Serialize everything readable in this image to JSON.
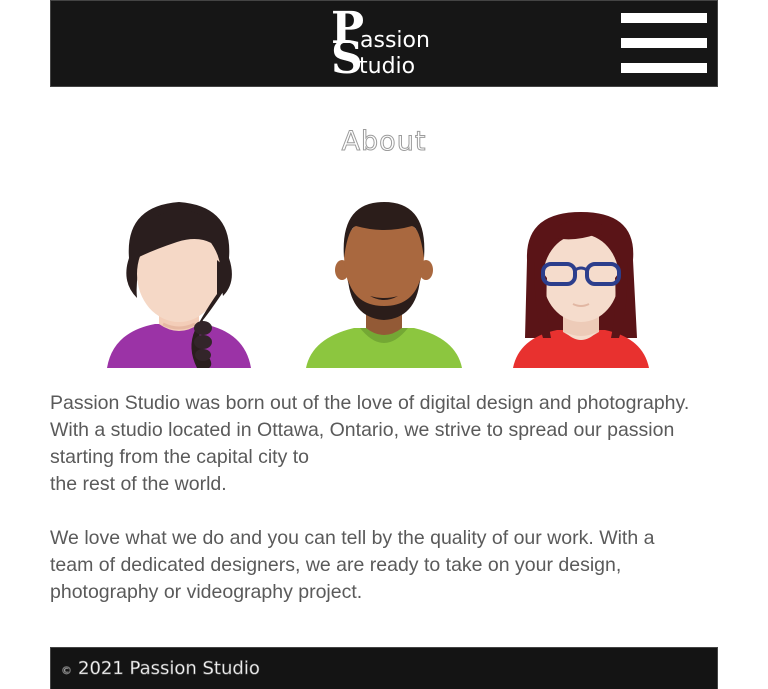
{
  "header": {
    "logo": {
      "p": "P",
      "s": "S",
      "line1": "assion",
      "line2": "tudio",
      "alt": "Passion Studio"
    },
    "menu_icon": "hamburger-menu-icon"
  },
  "main": {
    "title": "About",
    "avatars": [
      {
        "icon": "woman-braid-avatar-icon",
        "shirt": "#9b33a6",
        "hair": "#2a1e1e",
        "skin": "#f5d8c6"
      },
      {
        "icon": "man-beard-avatar-icon",
        "shirt": "#8cc63f",
        "hair": "#2b1d1a",
        "skin": "#a9683f"
      },
      {
        "icon": "woman-glasses-avatar-icon",
        "shirt": "#e8312f",
        "hair": "#5a1417",
        "skin": "#f5dccc"
      }
    ],
    "paragraph1_lines": [
      "Passion Studio was born out of the love of digital design and photography.",
      "With a studio located in Ottawa, Ontario, we strive to spread our passion",
      "starting from the capital city to",
      "the rest of the world."
    ],
    "paragraph2_lines": [
      "We love what we do and you can tell by the quality of our work. With a",
      "team of dedicated designers, we are ready to take on your design,",
      "photography or videography project."
    ]
  },
  "footer": {
    "symbol": "©",
    "text": "2021 Passion Studio"
  },
  "colors": {
    "header_bg": "#161616",
    "footer_bg": "#141414",
    "text": "#5a5a5a"
  }
}
